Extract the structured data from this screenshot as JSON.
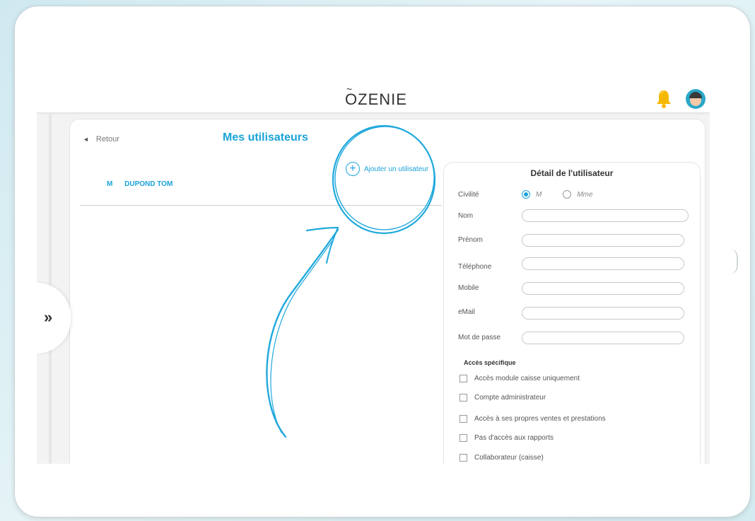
{
  "app": {
    "logo": "ZENIE",
    "logo_tilde": "~",
    "logo_o": "O"
  },
  "nav": {
    "expand_glyph": "»",
    "back_label": "Retour",
    "back_glyph": "◄"
  },
  "page": {
    "title": "Mes utilisateurs",
    "add_user_label": "Ajouter un utilisateur",
    "add_user_glyph": "+"
  },
  "users": [
    {
      "civility": "M",
      "name": "DUPOND TOM"
    }
  ],
  "detail": {
    "title": "Détail de l'utilisateur",
    "civility_label": "Civilité",
    "civility_options": [
      "M",
      "Mme"
    ],
    "civility_selected": "M",
    "fields": [
      {
        "label": "Nom",
        "value": ""
      },
      {
        "label": "Prénom",
        "value": ""
      },
      {
        "label": "Téléphone",
        "value": ""
      },
      {
        "label": "Mobile",
        "value": ""
      },
      {
        "label": "eMail",
        "value": ""
      },
      {
        "label": "Mot de passe",
        "value": ""
      }
    ],
    "access_section_label": "Accès spécifique",
    "access_options": [
      {
        "label": "Accès module caisse uniquement",
        "checked": false
      },
      {
        "label": "Compte administrateur",
        "checked": false
      },
      {
        "label": "Accès à ses propres ventes et prestations",
        "checked": false
      },
      {
        "label": "Pas d'accès aux rapports",
        "checked": false
      },
      {
        "label": "Collaborateur (caisse)",
        "checked": false
      }
    ]
  },
  "icons": {
    "notifications": "bell-icon",
    "profile": "avatar",
    "expand": "double-chevron-right-icon",
    "back": "triangle-left-icon",
    "add": "plus-circle-icon"
  },
  "colors": {
    "accent": "#1aa3d8",
    "bell": "#f5b800",
    "annotation": "#1fa8dc"
  }
}
